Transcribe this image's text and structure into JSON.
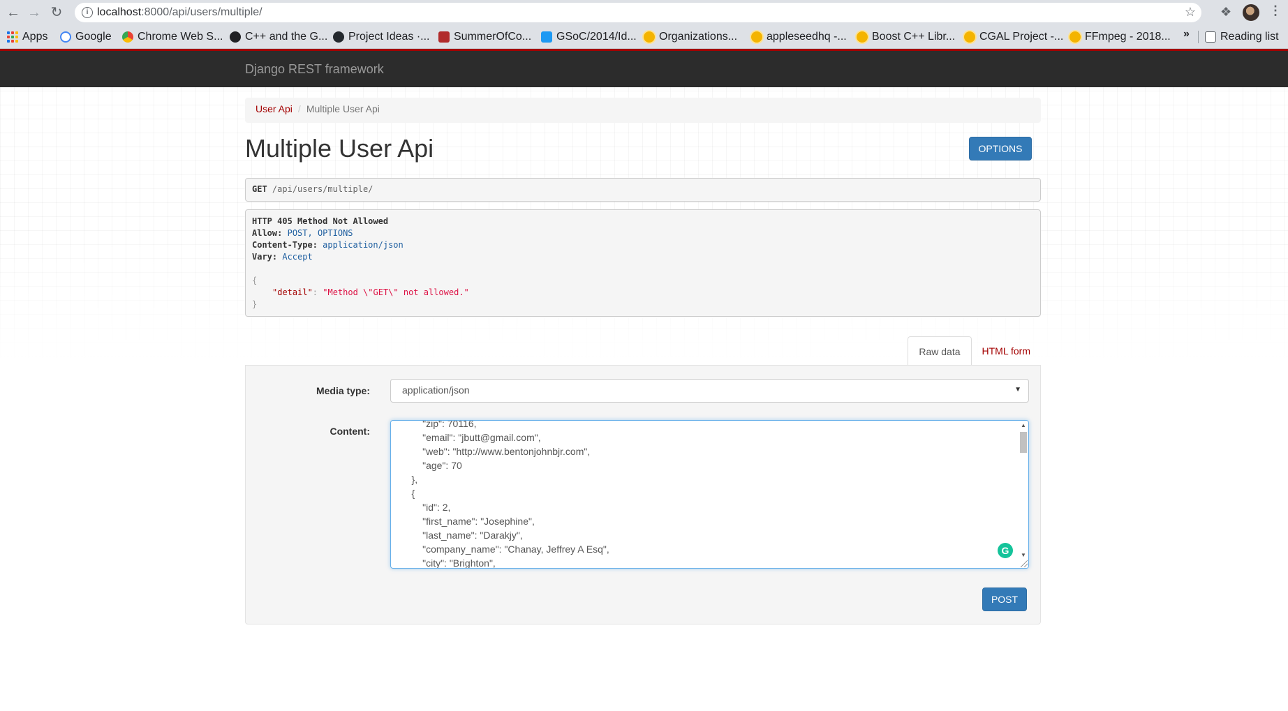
{
  "browser": {
    "url_host": "localhost",
    "url_rest": ":8000/api/users/multiple/",
    "bookmarks": [
      {
        "label": "Apps",
        "icon": "apps-grid-icon"
      },
      {
        "label": "Google",
        "icon": "google-icon"
      },
      {
        "label": "Chrome Web S...",
        "icon": "chrome-web-store-icon"
      },
      {
        "label": "C++ and the G...",
        "icon": "cpp-icon"
      },
      {
        "label": "Project Ideas ·...",
        "icon": "github-icon"
      },
      {
        "label": "SummerOfCo...",
        "icon": "summer-of-code-icon"
      },
      {
        "label": "GSoC/2014/Id...",
        "icon": "kde-icon"
      },
      {
        "label": "Organizations...",
        "icon": "gsoc-sun-icon"
      },
      {
        "label": "appleseedhq -...",
        "icon": "gsoc-sun-icon"
      },
      {
        "label": "Boost C++ Libr...",
        "icon": "gsoc-sun-icon"
      },
      {
        "label": "CGAL Project -...",
        "icon": "gsoc-sun-icon"
      },
      {
        "label": "FFmpeg - 2018...",
        "icon": "gsoc-sun-icon"
      }
    ],
    "more_bookmarks": "»",
    "reading_list": "Reading list"
  },
  "navbar": {
    "brand": "Django REST framework"
  },
  "breadcrumb": {
    "items": [
      "User Api",
      "Multiple User Api"
    ],
    "separator": "/"
  },
  "page": {
    "title": "Multiple User Api",
    "options_button": "OPTIONS"
  },
  "request": {
    "method": "GET",
    "path": "/api/users/multiple/"
  },
  "response": {
    "status_line": "HTTP 405 Method Not Allowed",
    "headers": [
      {
        "key": "Allow:",
        "value": "POST, OPTIONS"
      },
      {
        "key": "Content-Type:",
        "value": "application/json"
      },
      {
        "key": "Vary:",
        "value": "Accept"
      }
    ],
    "body_open": "{",
    "body_key": "\"detail\"",
    "body_colon": ": ",
    "body_value": "\"Method \\\"GET\\\" not allowed.\"",
    "body_close": "}"
  },
  "tabs": {
    "raw": "Raw data",
    "html": "HTML form"
  },
  "form": {
    "media_label": "Media type:",
    "media_value": "application/json",
    "content_label": "Content:",
    "content_lines": [
      "        \"zip\": 70116,",
      "        \"email\": \"jbutt@gmail.com\",",
      "        \"web\": \"http://www.bentonjohnbjr.com\",",
      "        \"age\": 70",
      "    },",
      "    {",
      "        \"id\": 2,",
      "        \"first_name\": \"Josephine\",",
      "        \"last_name\": \"Darakjy\",",
      "        \"company_name\": \"Chanay, Jeffrey A Esq\",",
      "        \"city\": \"Brighton\","
    ],
    "post_button": "POST"
  },
  "colors": {
    "accent": "#a30000",
    "navbar": "#2c2c2c",
    "primary_button": "#337ab7"
  }
}
